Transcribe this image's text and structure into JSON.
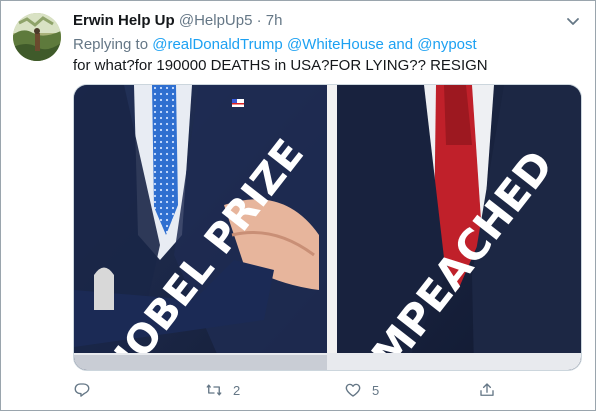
{
  "tweet": {
    "display_name": "Erwin Help Up",
    "handle": "@HelpUp5",
    "separator": "·",
    "time_ago": "7h",
    "replying_prefix": "Replying to",
    "mention_1": "@realDonaldTrump",
    "mention_2": "@WhiteHouse",
    "conjunction": "and",
    "mention_3": "@nypost",
    "text": "for what?for 190000 DEATHS in USA?FOR LYING?? RESIGN"
  },
  "media": {
    "left_overlay": "NOBEL PRIZE",
    "right_overlay": "IMPEACHED"
  },
  "actions": {
    "reply_count": "",
    "retweet_count": "2",
    "like_count": "5"
  },
  "icons": {
    "reply": "reply-icon",
    "retweet": "retweet-icon",
    "like": "like-icon",
    "share": "share-icon",
    "caret": "chevron-down-icon"
  },
  "colors": {
    "accent": "#1da1f2",
    "secondary_text": "#657786",
    "primary_text": "#14171a",
    "suit_navy": "#1c2a4a",
    "tie_blue": "#2f6fd0",
    "tie_red": "#c0202a"
  }
}
